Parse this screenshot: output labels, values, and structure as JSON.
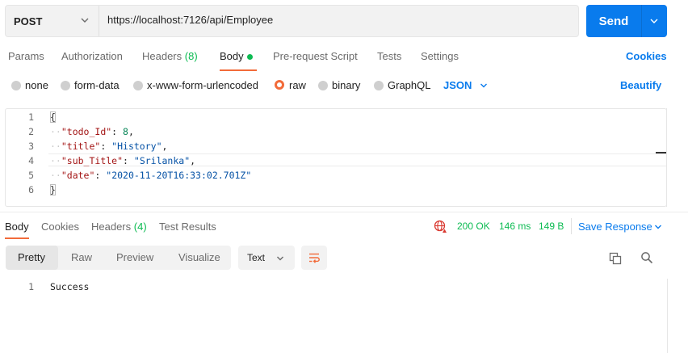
{
  "request": {
    "method": "POST",
    "url": "https://localhost:7126/api/Employee",
    "send_label": "Send"
  },
  "tabs": {
    "params": "Params",
    "authorization": "Authorization",
    "headers": "Headers",
    "headers_count": "(8)",
    "body": "Body",
    "prerequest": "Pre-request Script",
    "tests": "Tests",
    "settings": "Settings",
    "cookies": "Cookies"
  },
  "body_types": {
    "none": "none",
    "form_data": "form-data",
    "urlencoded": "x-www-form-urlencoded",
    "raw": "raw",
    "binary": "binary",
    "graphql": "GraphQL",
    "format": "JSON",
    "beautify": "Beautify"
  },
  "editor": {
    "line_numbers": [
      "1",
      "2",
      "3",
      "4",
      "5",
      "6"
    ],
    "open_brace": "{",
    "close_brace": "}",
    "fields": [
      {
        "key": "\"todo_Id\"",
        "value": "8",
        "type": "number"
      },
      {
        "key": "\"title\"",
        "value": "\"History\"",
        "type": "string"
      },
      {
        "key": "\"sub_Title\"",
        "value": "\"Srilanka\"",
        "type": "string"
      },
      {
        "key": "\"date\"",
        "value": "\"2020-11-20T16:33:02.701Z\"",
        "type": "string"
      }
    ]
  },
  "response": {
    "tabs": {
      "body": "Body",
      "cookies": "Cookies",
      "headers": "Headers",
      "headers_count": "(4)",
      "test_results": "Test Results"
    },
    "status": "200 OK",
    "time": "146 ms",
    "size": "149 B",
    "save_label": "Save Response",
    "view_modes": [
      "Pretty",
      "Raw",
      "Preview",
      "Visualize"
    ],
    "format": "Text",
    "line_number": "1",
    "content": "Success"
  },
  "colors": {
    "accent": "#f26b3a",
    "primary": "#097bed",
    "success": "#0cbb52"
  }
}
